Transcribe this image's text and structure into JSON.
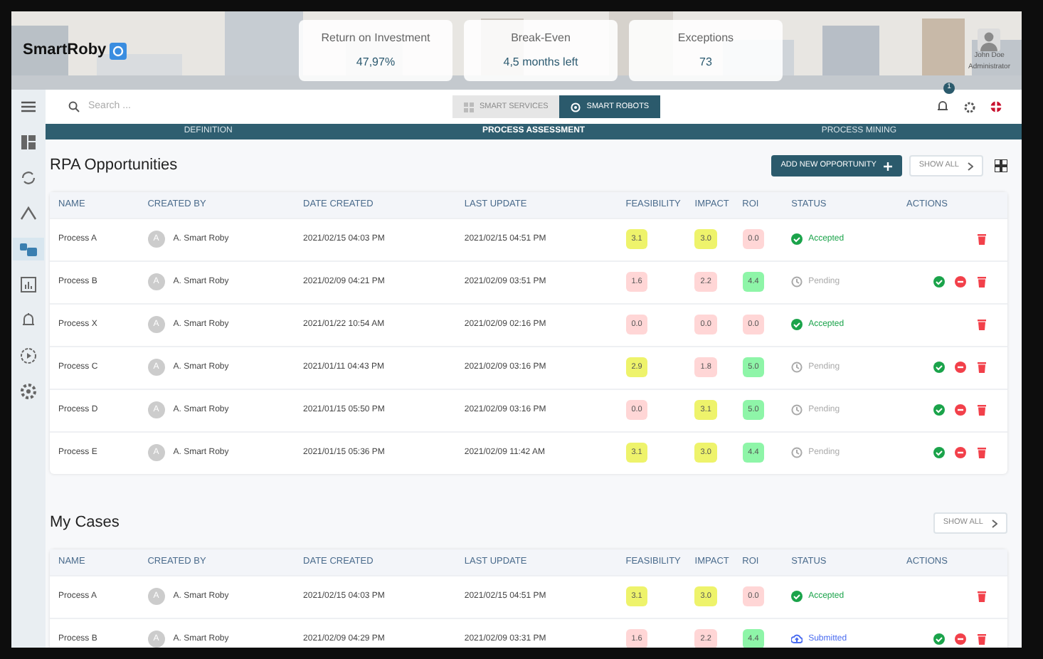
{
  "logo": {
    "text": "SmartRoby"
  },
  "kpis": [
    {
      "label": "Return on Investment",
      "value": "47,97%"
    },
    {
      "label": "Break-Even",
      "value": "4,5 months left"
    },
    {
      "label": "Exceptions",
      "value": "73"
    }
  ],
  "user": {
    "name": "John Doe",
    "role": "Administrator"
  },
  "sidebar": {
    "items": [
      {
        "kind": "menu",
        "selected": false
      },
      {
        "kind": "dashboard",
        "selected": false
      },
      {
        "kind": "sync",
        "selected": false
      },
      {
        "kind": "chevron",
        "selected": false
      },
      {
        "kind": "robots",
        "selected": true
      },
      {
        "kind": "chart",
        "selected": false
      },
      {
        "kind": "bell",
        "selected": false
      },
      {
        "kind": "play",
        "selected": false
      },
      {
        "kind": "settings",
        "selected": false
      }
    ]
  },
  "search": {
    "placeholder": "Search ..."
  },
  "mode_toggle": [
    {
      "label": "SMART SERVICES",
      "selected": false
    },
    {
      "label": "SMART ROBOTS",
      "selected": true
    }
  ],
  "notifications": {
    "count": "1"
  },
  "tabs": [
    {
      "label": "DEFINITION",
      "selected": false
    },
    {
      "label": "PROCESS ASSESSMENT",
      "selected": true
    },
    {
      "label": "PROCESS MINING",
      "selected": false
    }
  ],
  "opportunities": {
    "title": "RPA Opportunities",
    "add_button": "ADD NEW OPPORTUNITY",
    "show_all": "SHOW ALL",
    "columns": [
      "NAME",
      "CREATED BY",
      "DATE CREATED",
      "LAST UPDATE",
      "FEASIBILITY",
      "IMPACT",
      "ROI",
      "STATUS",
      "ACTIONS"
    ],
    "rows": [
      {
        "name": "Process A",
        "avatar": "A",
        "created_by": "A. Smart Roby",
        "date_created": "2021/02/15 04:03 PM",
        "last_update": "2021/02/15 04:51 PM",
        "scores": [
          {
            "value": "3.1",
            "color": "#eef36b"
          },
          {
            "value": "3.0",
            "color": "#eef36b"
          },
          {
            "value": "0.0",
            "color": "#ffd6d6"
          }
        ],
        "status": {
          "kind": "accepted",
          "label": "Accepted"
        },
        "actions": [
          {
            "kind": "delete"
          }
        ]
      },
      {
        "name": "Process B",
        "avatar": "A",
        "created_by": "A. Smart Roby",
        "date_created": "2021/02/09 04:21 PM",
        "last_update": "2021/02/09 03:51 PM",
        "scores": [
          {
            "value": "1.6",
            "color": "#ffd6d6"
          },
          {
            "value": "2.2",
            "color": "#ffd6d6"
          },
          {
            "value": "4.4",
            "color": "#8ef5a8"
          }
        ],
        "status": {
          "kind": "pending",
          "label": "Pending"
        },
        "actions": [
          {
            "kind": "approve"
          },
          {
            "kind": "reject"
          },
          {
            "kind": "delete"
          }
        ]
      },
      {
        "name": "Process X",
        "avatar": "A",
        "created_by": "A. Smart Roby",
        "date_created": "2021/01/22 10:54 AM",
        "last_update": "2021/02/09 02:16 PM",
        "scores": [
          {
            "value": "0.0",
            "color": "#ffd6d6"
          },
          {
            "value": "0.0",
            "color": "#ffd6d6"
          },
          {
            "value": "0.0",
            "color": "#ffd6d6"
          }
        ],
        "status": {
          "kind": "accepted",
          "label": "Accepted"
        },
        "actions": [
          {
            "kind": "delete"
          }
        ]
      },
      {
        "name": "Process C",
        "avatar": "A",
        "created_by": "A. Smart Roby",
        "date_created": "2021/01/11 04:43 PM",
        "last_update": "2021/02/09 03:16 PM",
        "scores": [
          {
            "value": "2.9",
            "color": "#eef36b"
          },
          {
            "value": "1.8",
            "color": "#ffd6d6"
          },
          {
            "value": "5.0",
            "color": "#8ef5a8"
          }
        ],
        "status": {
          "kind": "pending",
          "label": "Pending"
        },
        "actions": [
          {
            "kind": "approve"
          },
          {
            "kind": "reject"
          },
          {
            "kind": "delete"
          }
        ]
      },
      {
        "name": "Process D",
        "avatar": "A",
        "created_by": "A. Smart Roby",
        "date_created": "2021/01/15 05:50 PM",
        "last_update": "2021/02/09 03:16 PM",
        "scores": [
          {
            "value": "0.0",
            "color": "#ffd6d6"
          },
          {
            "value": "3.1",
            "color": "#eef36b"
          },
          {
            "value": "5.0",
            "color": "#8ef5a8"
          }
        ],
        "status": {
          "kind": "pending",
          "label": "Pending"
        },
        "actions": [
          {
            "kind": "approve"
          },
          {
            "kind": "reject"
          },
          {
            "kind": "delete"
          }
        ]
      },
      {
        "name": "Process E",
        "avatar": "A",
        "created_by": "A. Smart Roby",
        "date_created": "2021/01/15 05:36 PM",
        "last_update": "2021/02/09 11:42 AM",
        "scores": [
          {
            "value": "3.1",
            "color": "#eef36b"
          },
          {
            "value": "3.0",
            "color": "#eef36b"
          },
          {
            "value": "4.4",
            "color": "#8ef5a8"
          }
        ],
        "status": {
          "kind": "pending",
          "label": "Pending"
        },
        "actions": [
          {
            "kind": "approve"
          },
          {
            "kind": "reject"
          },
          {
            "kind": "delete"
          }
        ]
      }
    ]
  },
  "cases": {
    "title": "My Cases",
    "show_all": "SHOW ALL",
    "columns": [
      "NAME",
      "CREATED BY",
      "DATE CREATED",
      "LAST UPDATE",
      "FEASIBILITY",
      "IMPACT",
      "ROI",
      "STATUS",
      "ACTIONS"
    ],
    "rows": [
      {
        "name": "Process A",
        "avatar": "A",
        "created_by": "A. Smart Roby",
        "date_created": "2021/02/15 04:03 PM",
        "last_update": "2021/02/15 04:51 PM",
        "scores": [
          {
            "value": "3.1",
            "color": "#eef36b"
          },
          {
            "value": "3.0",
            "color": "#eef36b"
          },
          {
            "value": "0.0",
            "color": "#ffd6d6"
          }
        ],
        "status": {
          "kind": "accepted",
          "label": "Accepted"
        },
        "actions": [
          {
            "kind": "delete"
          }
        ]
      },
      {
        "name": "Process B",
        "avatar": "A",
        "created_by": "A. Smart Roby",
        "date_created": "2021/02/09 04:29 PM",
        "last_update": "2021/02/09 03:31 PM",
        "scores": [
          {
            "value": "1.6",
            "color": "#ffd6d6"
          },
          {
            "value": "2.2",
            "color": "#ffd6d6"
          },
          {
            "value": "4.4",
            "color": "#8ef5a8"
          }
        ],
        "status": {
          "kind": "submitted",
          "label": "Submitted"
        },
        "actions": [
          {
            "kind": "approve"
          },
          {
            "kind": "reject"
          },
          {
            "kind": "delete"
          }
        ]
      }
    ]
  }
}
